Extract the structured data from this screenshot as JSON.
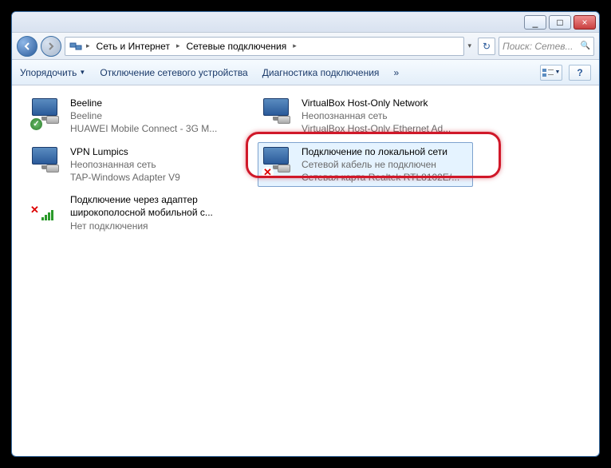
{
  "titlebar": {
    "minimize": "_",
    "maximize": "□",
    "close": "×"
  },
  "breadcrumb": {
    "segments": [
      "Сеть и Интернет",
      "Сетевые подключения"
    ]
  },
  "search": {
    "placeholder": "Поиск: Сетев..."
  },
  "toolbar": {
    "organize": "Упорядочить",
    "disable": "Отключение сетевого устройства",
    "diagnose": "Диагностика подключения",
    "more": "»"
  },
  "items": [
    {
      "name": "Beeline",
      "sub1": "Beeline",
      "sub2": "HUAWEI Mobile Connect - 3G M...",
      "badge": "ok"
    },
    {
      "name": "VirtualBox Host-Only Network",
      "sub1": "Неопознанная сеть",
      "sub2": "VirtualBox Host-Only Ethernet Ad...",
      "badge": ""
    },
    {
      "name": "VPN Lumpics",
      "sub1": "Неопознанная сеть",
      "sub2": "TAP-Windows Adapter V9",
      "badge": ""
    },
    {
      "name": "Подключение по локальной сети",
      "sub1": "Сетевой кабель не подключен",
      "sub2": "Сетевая карта Realtek RTL8102E/...",
      "badge": "err",
      "selected": true
    },
    {
      "name": "Подключение через адаптер широкополосной мобильной с...",
      "sub1": "Нет подключения",
      "sub2": "",
      "badge": "errsignal"
    }
  ]
}
